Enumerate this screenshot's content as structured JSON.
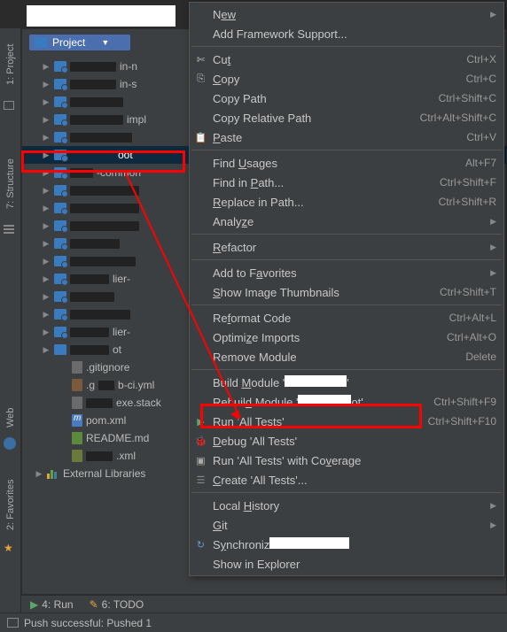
{
  "panel": {
    "title": "Project"
  },
  "rail": {
    "project": "1: Project",
    "structure": "7: Structure",
    "web": "Web",
    "favorites": "2: Favorites"
  },
  "tree": {
    "items": [
      {
        "label_suffix": "in-n",
        "type": "folder"
      },
      {
        "label_suffix": "in-s",
        "type": "folder"
      },
      {
        "label_suffix": "",
        "type": "folder"
      },
      {
        "label_suffix": "impl",
        "type": "folder"
      },
      {
        "label_suffix": "",
        "type": "folder"
      },
      {
        "label_suffix": "oot",
        "type": "folder",
        "selected": true
      },
      {
        "label_suffix": "-common",
        "type": "folder"
      },
      {
        "label_suffix": "",
        "type": "folder"
      },
      {
        "label_suffix": "",
        "type": "folder"
      },
      {
        "label_suffix": "",
        "type": "folder"
      },
      {
        "label_suffix": "",
        "type": "folder"
      },
      {
        "label_suffix": "",
        "type": "folder"
      },
      {
        "label_suffix": "lier-",
        "type": "folder"
      },
      {
        "label_suffix": "",
        "type": "folder"
      },
      {
        "label_suffix": "",
        "type": "folder"
      },
      {
        "label_suffix": "lier-",
        "type": "folder"
      },
      {
        "label_suffix": "ot",
        "type": "folder"
      }
    ],
    "files": [
      {
        "name": ".gitignore",
        "icon": "file"
      },
      {
        "prefix": ".g",
        "suffix": "b-ci.yml",
        "icon": "yml"
      },
      {
        "prefix": "",
        "suffix": "exe.stack",
        "icon": "file"
      },
      {
        "name": "pom.xml",
        "icon": "m"
      },
      {
        "name": "README.md",
        "icon": "md"
      },
      {
        "prefix": "",
        "suffix": ".xml",
        "icon": "xml"
      }
    ],
    "external": "External Libraries"
  },
  "context": {
    "new": "ew",
    "add_fw": "Add Framework Support...",
    "cut": "t",
    "copy": "opy",
    "copy_path": "Copy Path",
    "copy_rel": "Copy Relative Path",
    "paste": "aste",
    "find_usages": "Find ",
    "find_usages2": "sages",
    "find_path": "Find in ",
    "find_path2": "ath...",
    "replace_path": "eplace in Path...",
    "analyze": "Analy",
    "analyze2": "e",
    "refactor": "efactor",
    "favorites": "Add to F",
    "favorites2": "vorites",
    "thumb": "how Image Thumbnails",
    "reformat": "Re",
    "reformat2": "ormat Code",
    "optimize": "Optimi",
    "optimize2": "e Imports",
    "remove_mod": "Remove Module",
    "build_mod": "Build ",
    "build_mod2": "odule '",
    "rebuild_mod": "Rebuil",
    "rebuild_mod2": " Module '",
    "rebuild_mod3": "ot'",
    "run": "un 'All Tests'",
    "debug": "ebug 'All Tests'",
    "coverage": "Run 'All Tests' with Co",
    "coverage2": "erage",
    "create_tests": "reate 'All Tests'...",
    "local_hist": "Local ",
    "local_hist2": "istory",
    "git": "it",
    "sync": "S",
    "sync2": "nchroniz",
    "explorer": "Show in Explorer",
    "sc": {
      "cut": "Ctrl+X",
      "copy": "Ctrl+C",
      "copy_path": "Ctrl+Shift+C",
      "copy_rel": "Ctrl+Alt+Shift+C",
      "paste": "Ctrl+V",
      "find_usages": "Alt+F7",
      "find_path": "Ctrl+Shift+F",
      "replace_path": "Ctrl+Shift+R",
      "thumb": "Ctrl+Shift+T",
      "reformat": "Ctrl+Alt+L",
      "optimize": "Ctrl+Alt+O",
      "remove_mod": "Delete",
      "rebuild": "Ctrl+Shift+F9",
      "run": "Ctrl+Shift+F10"
    }
  },
  "bottom": {
    "run": "Run",
    "run_mn": "4",
    "todo": "TODO",
    "todo_mn": "6",
    "status": "Push successful: Pushed 1"
  }
}
